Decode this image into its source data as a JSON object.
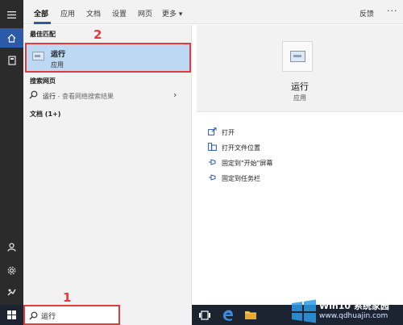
{
  "tabs": {
    "items": [
      "全部",
      "应用",
      "文档",
      "设置",
      "网页",
      "更多 ▾"
    ],
    "feedback": "反馈",
    "more": "···"
  },
  "results": {
    "best_match_header": "最佳匹配",
    "best_match": {
      "name": "运行",
      "type": "应用"
    },
    "web_header": "搜索网页",
    "web_query": "运行",
    "web_hint": " - 查看网络搜索结果",
    "docs_header": "文档 (1+)"
  },
  "detail": {
    "title": "运行",
    "subtitle": "应用",
    "actions": [
      "打开",
      "打开文件位置",
      "固定到\"开始\"屏幕",
      "固定到任务栏"
    ]
  },
  "search": {
    "value": "运行"
  },
  "markers": {
    "one": "1",
    "two": "2"
  },
  "watermark": {
    "line1": "Win10 系统家园",
    "line2": "www.qdhuajin.com"
  },
  "colors": {
    "accent": "#2b5aa8",
    "highlight": "#bcd8f2",
    "annotation_red": "#e23b3b",
    "taskbar": "#1c2331"
  }
}
